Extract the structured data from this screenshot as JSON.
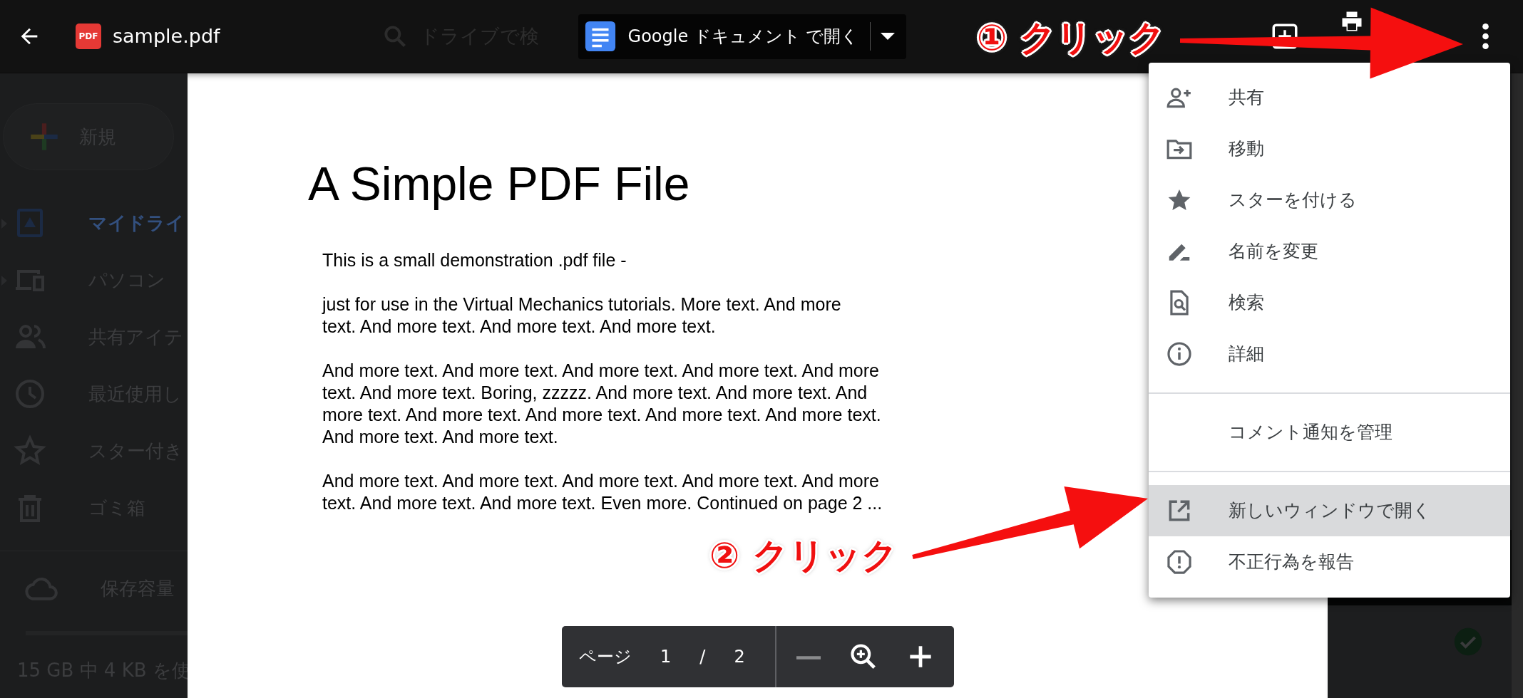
{
  "top_bar": {
    "file_badge": "PDF",
    "file_name": "sample.pdf",
    "search_placeholder": "ドライブで検",
    "open_with": {
      "label": "Google ドキュメント で開く"
    }
  },
  "sidebar": {
    "new_button": "新規",
    "items": [
      {
        "label": "マイドライ",
        "selected": true,
        "expandable": true
      },
      {
        "label": "パソコン",
        "selected": false,
        "expandable": true
      },
      {
        "label": "共有アイテ",
        "selected": false,
        "expandable": false
      },
      {
        "label": "最近使用し",
        "selected": false,
        "expandable": false
      },
      {
        "label": "スター付き",
        "selected": false,
        "expandable": false
      },
      {
        "label": "ゴミ箱",
        "selected": false,
        "expandable": false
      }
    ],
    "storage": {
      "label": "保存容量",
      "usage": "15 GB 中 4 KB を使"
    }
  },
  "document": {
    "title": "A Simple PDF File",
    "paragraphs": [
      {
        "lines": [
          "This is a small demonstration .pdf file -"
        ]
      },
      {
        "lines": [
          "just for use in the Virtual Mechanics tutorials. More text. And more",
          "text. And more text. And more text. And more text."
        ]
      },
      {
        "lines": [
          "And more text. And more text. And more text. And more text. And more",
          "text. And more text. Boring, zzzzz. And more text. And more text. And",
          "more text. And more text. And more text. And more text. And more text.",
          "And more text. And more text."
        ]
      },
      {
        "lines": [
          "And more text. And more text. And more text. And more text. And more",
          "text. And more text. And more text. Even more. Continued on page 2 ..."
        ]
      }
    ]
  },
  "pager": {
    "label": "ページ",
    "current": "1",
    "separator": "/",
    "total": "2",
    "zoom_out_disabled": true
  },
  "menu": {
    "sections": [
      [
        {
          "label": "共有",
          "selected": false
        },
        {
          "label": "移動",
          "selected": false
        },
        {
          "label": "スターを付ける",
          "selected": false
        },
        {
          "label": "名前を変更",
          "selected": false
        },
        {
          "label": "検索",
          "selected": false
        },
        {
          "label": "詳細",
          "selected": false
        }
      ],
      [
        {
          "label": "コメント通知を管理",
          "selected": false
        }
      ],
      [
        {
          "label": "新しいウィンドウで開く",
          "selected": true
        },
        {
          "label": "不正行為を報告",
          "selected": false
        }
      ]
    ]
  },
  "annotations": [
    {
      "label": "① クリック"
    },
    {
      "label": "② クリック"
    }
  ]
}
